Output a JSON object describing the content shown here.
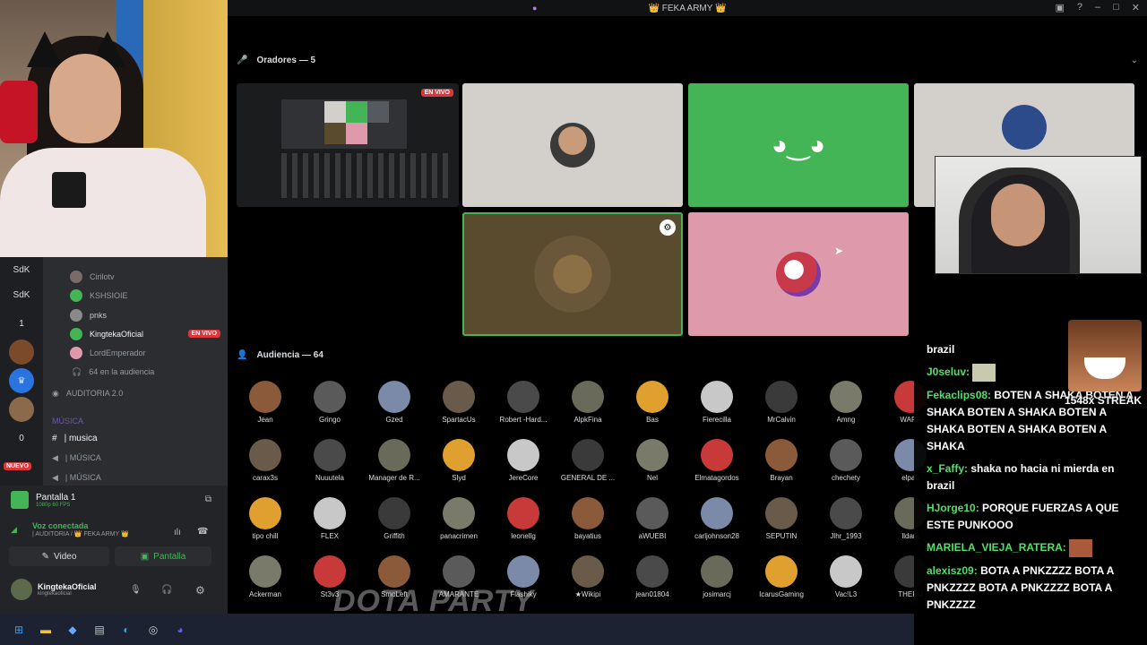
{
  "window": {
    "title": "👑 FEKA ARMY 👑",
    "title_icon": "stage-channel-icon"
  },
  "stage": {
    "speakers_label": "Oradores — 5",
    "audience_label": "Audiencia — 64",
    "live_badge": "EN VIVO"
  },
  "sidebar": {
    "servers": [
      "SdK",
      "SdK",
      "1",
      "",
      "",
      "",
      "0"
    ],
    "new_badge": "NUEVO",
    "members": [
      {
        "name": "Cirilotv"
      },
      {
        "name": "KSHSIOIE"
      },
      {
        "name": "pnks"
      },
      {
        "name": "KingtekaOficial",
        "live": "EN VIVO"
      },
      {
        "name": "LordEmperador"
      }
    ],
    "audience_count": "64 en la audiencia",
    "channels": [
      {
        "name": "AUDITORIA 2.0"
      },
      {
        "name": "MÚSICA"
      },
      {
        "name": "| musica"
      },
      {
        "name": "| MÚSICA"
      },
      {
        "name": "| MÚSICA"
      }
    ]
  },
  "stream_panel": {
    "screen_title": "Pantalla 1",
    "screen_sub": "1080p 60 FPS",
    "voice_status": "Voz conectada",
    "voice_channel": "| AUDITORIA / 👑 FEKA ARMY 👑",
    "video_btn": "Video",
    "screen_btn": "Pantalla",
    "user_name": "KingtekaOficial",
    "user_tag": "kingtekaoficial"
  },
  "audience": [
    [
      "Jean",
      "Gringo",
      "Gzed",
      "SpartacUs",
      "Robert -Hard...",
      "AlpkFina",
      "Bas",
      "Fierecilla",
      "MrCalvin",
      "Amng",
      "WARF"
    ],
    [
      "carax3s",
      "Nuuutela",
      "Manager de R...",
      "Slyd",
      "JereCore",
      "GENERAL DE ...",
      "Nel",
      "Elmatagordos",
      "Brayan",
      "chechety",
      "elpan"
    ],
    [
      "tipo chill",
      "FLEX",
      "Griffith",
      "panacrimen",
      "leonellg",
      "bayatius",
      "aWUEBI",
      "carljohnson28",
      "SEPUTIN",
      "Jlhr_1993",
      "lldark"
    ],
    [
      "Ackerman",
      "St3v3",
      "SmoLeft",
      "AMARANTE",
      "Flashiky",
      "★Wikipi",
      "jean01804",
      "josimarcj",
      "IcarusGaming",
      "Vac!L3",
      "THERU"
    ]
  ],
  "chat": [
    {
      "user": "",
      "text": "brazil"
    },
    {
      "user": "J0seluv:",
      "text": ""
    },
    {
      "user": "Fekaclips08:",
      "text": "BOTEN A SHAKA BOTEN A SHAKA BOTEN A SHAKA BOTEN A SHAKA BOTEN A SHAKA BOTEN A SHAKA"
    },
    {
      "user": "x_Faffy:",
      "text": "shaka no hacia ni mierda en brazil"
    },
    {
      "user": "HJorge10:",
      "text": "PORQUE FUERZAS A QUE ESTE PUNKOOO"
    },
    {
      "user": "MARIELA_VIEJA_RATERA:",
      "text": ""
    },
    {
      "user": "alexisz09:",
      "text": "BOTA A PNKZZZZ BOTA A PNKZZZZ BOTA A PNKZZZZ BOTA A PNKZZZZ"
    }
  ],
  "overlay": {
    "streak": "1548x STREAK",
    "watermark": "DOTA PARTY",
    "kick_logo": "K"
  },
  "colors": {
    "discord_blurple": "#5865f2",
    "green_tile": "#43b556",
    "pink_tile": "#de9aaa",
    "grey_tile": "#d3cfcb",
    "gold_tile": "#5a4a2e",
    "live_red": "#da373c",
    "chat_user": "#52e06a"
  }
}
